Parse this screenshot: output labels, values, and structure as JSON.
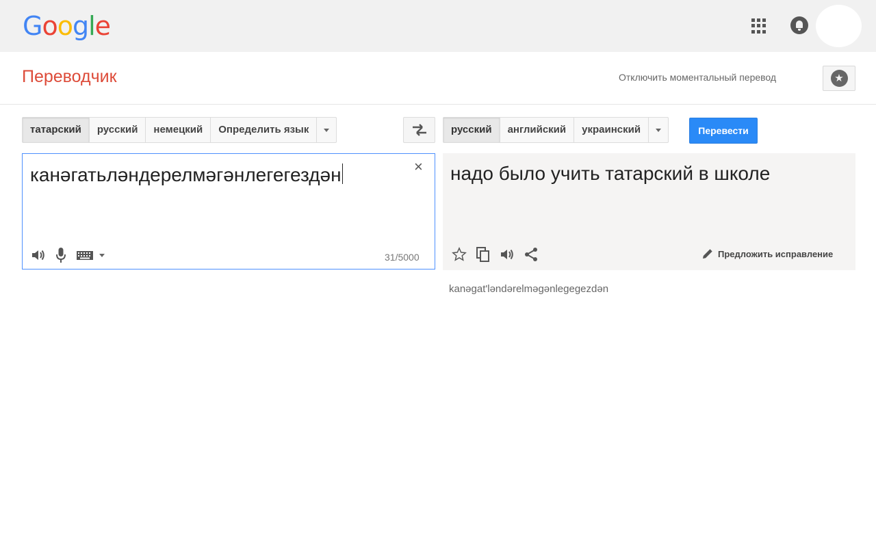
{
  "header": {
    "logo_letters": [
      "G",
      "o",
      "o",
      "g",
      "l",
      "e"
    ],
    "logo_colors": [
      "#4285F4",
      "#EA4335",
      "#FBBC05",
      "#4285F4",
      "#34A853",
      "#EA4335"
    ]
  },
  "subheader": {
    "title": "Переводчик",
    "instant_toggle": "Отключить моментальный перевод"
  },
  "source": {
    "languages": [
      "татарский",
      "русский",
      "немецкий",
      "Определить язык"
    ],
    "active_index": 0,
    "text": "канәгатьләндерелмәгәнлегегездән",
    "char_count": "31/5000",
    "clear_symbol": "×"
  },
  "target": {
    "languages": [
      "русский",
      "английский",
      "украинский"
    ],
    "active_index": 0,
    "text": "надо было учить татарский в школе",
    "translit": "kanəgat'ləndərelməgənlegegezdən",
    "suggest_label": "Предложить исправление"
  },
  "actions": {
    "translate_label": "Перевести"
  },
  "colors": {
    "title": "#dd4b39",
    "translate_button": "#2a8af7",
    "source_border": "#4d90fe"
  }
}
